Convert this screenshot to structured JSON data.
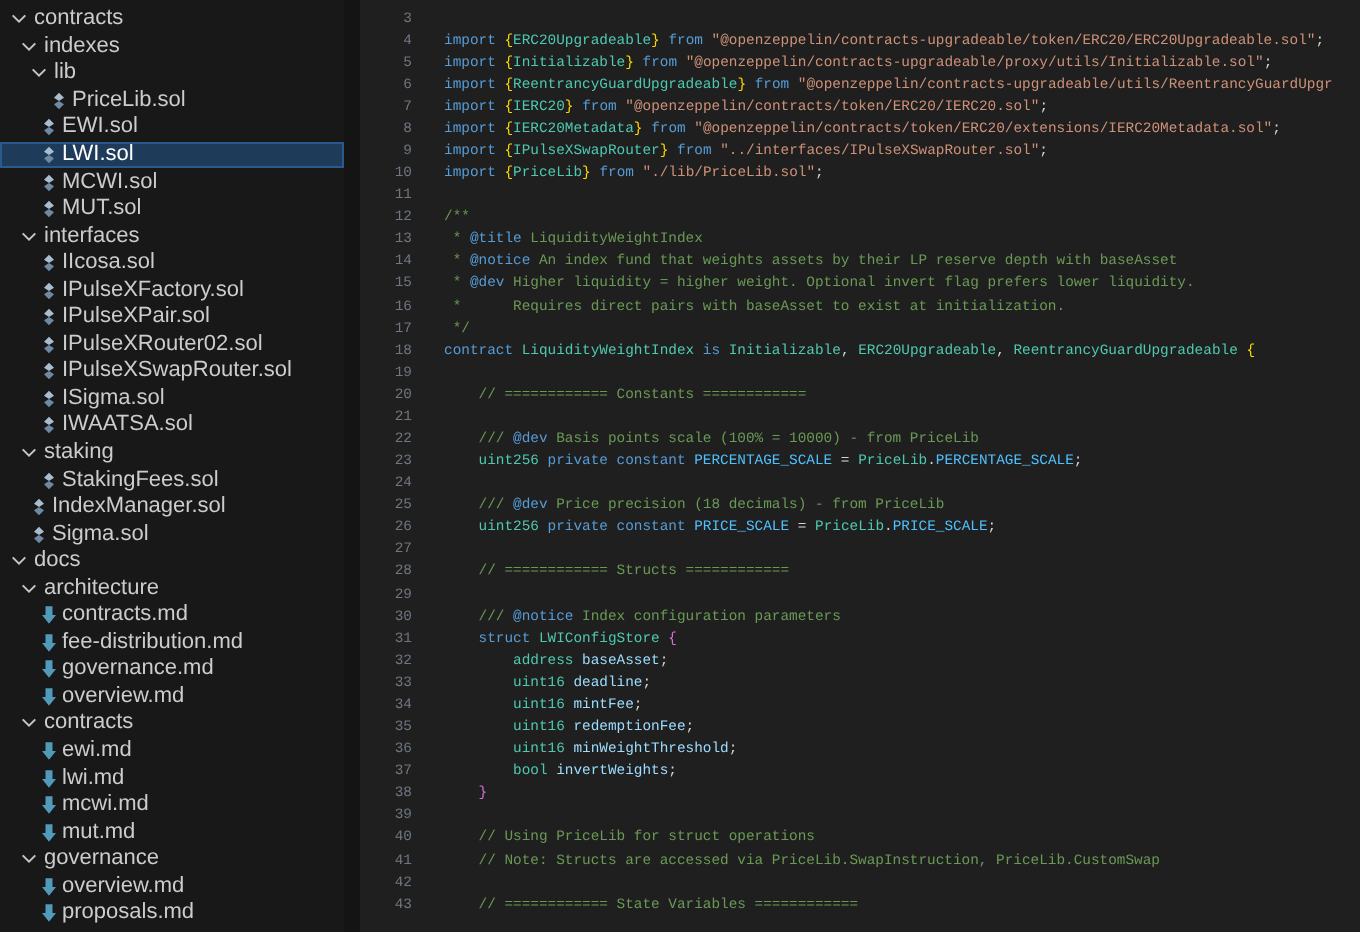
{
  "explorer": {
    "items": [
      {
        "kind": "folder",
        "name": "contracts",
        "expanded": true,
        "selected": false,
        "children": [
          {
            "kind": "folder",
            "name": "indexes",
            "expanded": true,
            "selected": false,
            "children": [
              {
                "kind": "folder",
                "name": "lib",
                "expanded": true,
                "selected": false,
                "children": [
                  {
                    "kind": "sol",
                    "name": "PriceLib.sol",
                    "selected": false
                  }
                ]
              },
              {
                "kind": "sol",
                "name": "EWI.sol",
                "selected": false
              },
              {
                "kind": "sol",
                "name": "LWI.sol",
                "selected": true
              },
              {
                "kind": "sol",
                "name": "MCWI.sol",
                "selected": false
              },
              {
                "kind": "sol",
                "name": "MUT.sol",
                "selected": false
              }
            ]
          },
          {
            "kind": "folder",
            "name": "interfaces",
            "expanded": true,
            "selected": false,
            "children": [
              {
                "kind": "sol",
                "name": "IIcosa.sol",
                "selected": false
              },
              {
                "kind": "sol",
                "name": "IPulseXFactory.sol",
                "selected": false
              },
              {
                "kind": "sol",
                "name": "IPulseXPair.sol",
                "selected": false
              },
              {
                "kind": "sol",
                "name": "IPulseXRouter02.sol",
                "selected": false
              },
              {
                "kind": "sol",
                "name": "IPulseXSwapRouter.sol",
                "selected": false
              },
              {
                "kind": "sol",
                "name": "ISigma.sol",
                "selected": false
              },
              {
                "kind": "sol",
                "name": "IWAATSA.sol",
                "selected": false
              }
            ]
          },
          {
            "kind": "folder",
            "name": "staking",
            "expanded": true,
            "selected": false,
            "children": [
              {
                "kind": "sol",
                "name": "StakingFees.sol",
                "selected": false
              }
            ]
          },
          {
            "kind": "sol",
            "name": "IndexManager.sol",
            "selected": false
          },
          {
            "kind": "sol",
            "name": "Sigma.sol",
            "selected": false
          }
        ]
      },
      {
        "kind": "folder",
        "name": "docs",
        "expanded": true,
        "selected": false,
        "children": [
          {
            "kind": "folder",
            "name": "architecture",
            "expanded": true,
            "selected": false,
            "children": [
              {
                "kind": "md",
                "name": "contracts.md",
                "selected": false
              },
              {
                "kind": "md",
                "name": "fee-distribution.md",
                "selected": false
              },
              {
                "kind": "md",
                "name": "governance.md",
                "selected": false
              },
              {
                "kind": "md",
                "name": "overview.md",
                "selected": false
              }
            ]
          },
          {
            "kind": "folder",
            "name": "contracts",
            "expanded": true,
            "selected": false,
            "children": [
              {
                "kind": "md",
                "name": "ewi.md",
                "selected": false
              },
              {
                "kind": "md",
                "name": "lwi.md",
                "selected": false
              },
              {
                "kind": "md",
                "name": "mcwi.md",
                "selected": false
              },
              {
                "kind": "md",
                "name": "mut.md",
                "selected": false
              }
            ]
          },
          {
            "kind": "folder",
            "name": "governance",
            "expanded": true,
            "selected": false,
            "children": [
              {
                "kind": "md",
                "name": "overview.md",
                "selected": false
              },
              {
                "kind": "md",
                "name": "proposals.md",
                "selected": false
              }
            ]
          }
        ]
      }
    ]
  },
  "editor": {
    "lines": [
      {
        "number": "3"
      },
      {
        "number": "4",
        "tokens": [
          {
            "kind": "keyword",
            "text": "import "
          },
          {
            "kind": "bracket",
            "text": "{"
          },
          {
            "kind": "type",
            "text": "ERC20Upgradeable"
          },
          {
            "kind": "bracket",
            "text": "}"
          },
          {
            "kind": "keyword",
            "text": " from "
          },
          {
            "kind": "string",
            "text": "\"@openzeppelin/contracts-upgradeable/token/ERC20/ERC20Upgradeable.sol\""
          },
          {
            "kind": "plain",
            "text": ";"
          }
        ]
      },
      {
        "number": "5",
        "tokens": [
          {
            "kind": "keyword",
            "text": "import "
          },
          {
            "kind": "bracket",
            "text": "{"
          },
          {
            "kind": "type",
            "text": "Initializable"
          },
          {
            "kind": "bracket",
            "text": "}"
          },
          {
            "kind": "keyword",
            "text": " from "
          },
          {
            "kind": "string",
            "text": "\"@openzeppelin/contracts-upgradeable/proxy/utils/Initializable.sol\""
          },
          {
            "kind": "plain",
            "text": ";"
          }
        ]
      },
      {
        "number": "6",
        "tokens": [
          {
            "kind": "keyword",
            "text": "import "
          },
          {
            "kind": "bracket",
            "text": "{"
          },
          {
            "kind": "type",
            "text": "ReentrancyGuardUpgradeable"
          },
          {
            "kind": "bracket",
            "text": "}"
          },
          {
            "kind": "keyword",
            "text": " from "
          },
          {
            "kind": "string",
            "text": "\"@openzeppelin/contracts-upgradeable/utils/ReentrancyGuardUpgr"
          }
        ]
      },
      {
        "number": "7",
        "tokens": [
          {
            "kind": "keyword",
            "text": "import "
          },
          {
            "kind": "bracket",
            "text": "{"
          },
          {
            "kind": "type",
            "text": "IERC20"
          },
          {
            "kind": "bracket",
            "text": "}"
          },
          {
            "kind": "keyword",
            "text": " from "
          },
          {
            "kind": "string",
            "text": "\"@openzeppelin/contracts/token/ERC20/IERC20.sol\""
          },
          {
            "kind": "plain",
            "text": ";"
          }
        ]
      },
      {
        "number": "8",
        "tokens": [
          {
            "kind": "keyword",
            "text": "import "
          },
          {
            "kind": "bracket",
            "text": "{"
          },
          {
            "kind": "type",
            "text": "IERC20Metadata"
          },
          {
            "kind": "bracket",
            "text": "}"
          },
          {
            "kind": "keyword",
            "text": " from "
          },
          {
            "kind": "string",
            "text": "\"@openzeppelin/contracts/token/ERC20/extensions/IERC20Metadata.sol\""
          },
          {
            "kind": "plain",
            "text": ";"
          }
        ]
      },
      {
        "number": "9",
        "tokens": [
          {
            "kind": "keyword",
            "text": "import "
          },
          {
            "kind": "bracket",
            "text": "{"
          },
          {
            "kind": "type",
            "text": "IPulseXSwapRouter"
          },
          {
            "kind": "bracket",
            "text": "}"
          },
          {
            "kind": "keyword",
            "text": " from "
          },
          {
            "kind": "string",
            "text": "\"../interfaces/IPulseXSwapRouter.sol\""
          },
          {
            "kind": "plain",
            "text": ";"
          }
        ]
      },
      {
        "number": "10",
        "tokens": [
          {
            "kind": "keyword",
            "text": "import "
          },
          {
            "kind": "bracket",
            "text": "{"
          },
          {
            "kind": "type",
            "text": "PriceLib"
          },
          {
            "kind": "bracket",
            "text": "}"
          },
          {
            "kind": "keyword",
            "text": " from "
          },
          {
            "kind": "string",
            "text": "\"./lib/PriceLib.sol\""
          },
          {
            "kind": "plain",
            "text": ";"
          }
        ]
      },
      {
        "number": "11"
      },
      {
        "number": "12",
        "tokens": [
          {
            "kind": "comment",
            "text": "/**"
          }
        ]
      },
      {
        "number": "13",
        "tokens": [
          {
            "kind": "comment",
            "text": " * "
          },
          {
            "kind": "doctag",
            "text": "@title"
          },
          {
            "kind": "comment",
            "text": " LiquidityWeightIndex"
          }
        ]
      },
      {
        "number": "14",
        "tokens": [
          {
            "kind": "comment",
            "text": " * "
          },
          {
            "kind": "doctag",
            "text": "@notice"
          },
          {
            "kind": "comment",
            "text": " An index fund that weights assets by their LP reserve depth with baseAsset"
          }
        ]
      },
      {
        "number": "15",
        "tokens": [
          {
            "kind": "comment",
            "text": " * "
          },
          {
            "kind": "doctag",
            "text": "@dev"
          },
          {
            "kind": "comment",
            "text": " Higher liquidity = higher weight. Optional invert flag prefers lower liquidity."
          }
        ]
      },
      {
        "number": "16",
        "tokens": [
          {
            "kind": "comment",
            "text": " *      Requires direct pairs with baseAsset to exist at initialization."
          }
        ]
      },
      {
        "number": "17",
        "tokens": [
          {
            "kind": "comment",
            "text": " */"
          }
        ]
      },
      {
        "number": "18",
        "tokens": [
          {
            "kind": "keyword",
            "text": "contract "
          },
          {
            "kind": "type",
            "text": "LiquidityWeightIndex"
          },
          {
            "kind": "keyword",
            "text": " is "
          },
          {
            "kind": "type",
            "text": "Initializable"
          },
          {
            "kind": "plain",
            "text": ", "
          },
          {
            "kind": "type",
            "text": "ERC20Upgradeable"
          },
          {
            "kind": "plain",
            "text": ", "
          },
          {
            "kind": "type",
            "text": "ReentrancyGuardUpgradeable"
          },
          {
            "kind": "bracket",
            "text": " {"
          }
        ]
      },
      {
        "number": "19"
      },
      {
        "number": "20",
        "tokens": [
          {
            "kind": "comment",
            "text": "    // ============ Constants ============"
          }
        ]
      },
      {
        "number": "21"
      },
      {
        "number": "22",
        "tokens": [
          {
            "kind": "comment",
            "text": "    /// "
          },
          {
            "kind": "doctag",
            "text": "@dev"
          },
          {
            "kind": "comment",
            "text": " Basis points scale (100% = 10000) - from PriceLib"
          }
        ]
      },
      {
        "number": "23",
        "tokens": [
          {
            "kind": "type",
            "text": "    uint256"
          },
          {
            "kind": "keyword",
            "text": " private constant "
          },
          {
            "kind": "constant",
            "text": "PERCENTAGE_SCALE"
          },
          {
            "kind": "plain",
            "text": " = "
          },
          {
            "kind": "type",
            "text": "PriceLib"
          },
          {
            "kind": "plain",
            "text": "."
          },
          {
            "kind": "constant",
            "text": "PERCENTAGE_SCALE"
          },
          {
            "kind": "plain",
            "text": ";"
          }
        ]
      },
      {
        "number": "24"
      },
      {
        "number": "25",
        "tokens": [
          {
            "kind": "comment",
            "text": "    /// "
          },
          {
            "kind": "doctag",
            "text": "@dev"
          },
          {
            "kind": "comment",
            "text": " Price precision (18 decimals) - from PriceLib"
          }
        ]
      },
      {
        "number": "26",
        "tokens": [
          {
            "kind": "type",
            "text": "    uint256"
          },
          {
            "kind": "keyword",
            "text": " private constant "
          },
          {
            "kind": "constant",
            "text": "PRICE_SCALE"
          },
          {
            "kind": "plain",
            "text": " = "
          },
          {
            "kind": "type",
            "text": "PriceLib"
          },
          {
            "kind": "plain",
            "text": "."
          },
          {
            "kind": "constant",
            "text": "PRICE_SCALE"
          },
          {
            "kind": "plain",
            "text": ";"
          }
        ]
      },
      {
        "number": "27"
      },
      {
        "number": "28",
        "tokens": [
          {
            "kind": "comment",
            "text": "    // ============ Structs ============"
          }
        ]
      },
      {
        "number": "29"
      },
      {
        "number": "30",
        "tokens": [
          {
            "kind": "comment",
            "text": "    /// "
          },
          {
            "kind": "doctag",
            "text": "@notice"
          },
          {
            "kind": "comment",
            "text": " Index configuration parameters"
          }
        ]
      },
      {
        "number": "31",
        "tokens": [
          {
            "kind": "keyword",
            "text": "    struct "
          },
          {
            "kind": "type",
            "text": "LWIConfigStore"
          },
          {
            "kind": "bracket2",
            "text": " {"
          }
        ]
      },
      {
        "number": "32",
        "tokens": [
          {
            "kind": "type",
            "text": "        address"
          },
          {
            "kind": "variable",
            "text": " baseAsset"
          },
          {
            "kind": "plain",
            "text": ";"
          }
        ]
      },
      {
        "number": "33",
        "tokens": [
          {
            "kind": "type",
            "text": "        uint16"
          },
          {
            "kind": "variable",
            "text": " deadline"
          },
          {
            "kind": "plain",
            "text": ";"
          }
        ]
      },
      {
        "number": "34",
        "tokens": [
          {
            "kind": "type",
            "text": "        uint16"
          },
          {
            "kind": "variable",
            "text": " mintFee"
          },
          {
            "kind": "plain",
            "text": ";"
          }
        ]
      },
      {
        "number": "35",
        "tokens": [
          {
            "kind": "type",
            "text": "        uint16"
          },
          {
            "kind": "variable",
            "text": " redemptionFee"
          },
          {
            "kind": "plain",
            "text": ";"
          }
        ]
      },
      {
        "number": "36",
        "tokens": [
          {
            "kind": "type",
            "text": "        uint16"
          },
          {
            "kind": "variable",
            "text": " minWeightThreshold"
          },
          {
            "kind": "plain",
            "text": ";"
          }
        ]
      },
      {
        "number": "37",
        "tokens": [
          {
            "kind": "type",
            "text": "        bool"
          },
          {
            "kind": "variable",
            "text": " invertWeights"
          },
          {
            "kind": "plain",
            "text": ";"
          }
        ]
      },
      {
        "number": "38",
        "tokens": [
          {
            "kind": "bracket2",
            "text": "    }"
          }
        ]
      },
      {
        "number": "39"
      },
      {
        "number": "40",
        "tokens": [
          {
            "kind": "comment",
            "text": "    // Using PriceLib for struct operations"
          }
        ]
      },
      {
        "number": "41",
        "tokens": [
          {
            "kind": "comment",
            "text": "    // Note: Structs are accessed via PriceLib.SwapInstruction, PriceLib.CustomSwap"
          }
        ]
      },
      {
        "number": "42"
      },
      {
        "number": "43",
        "tokens": [
          {
            "kind": "comment",
            "text": "    // ============ State Variables ============"
          }
        ]
      }
    ]
  }
}
